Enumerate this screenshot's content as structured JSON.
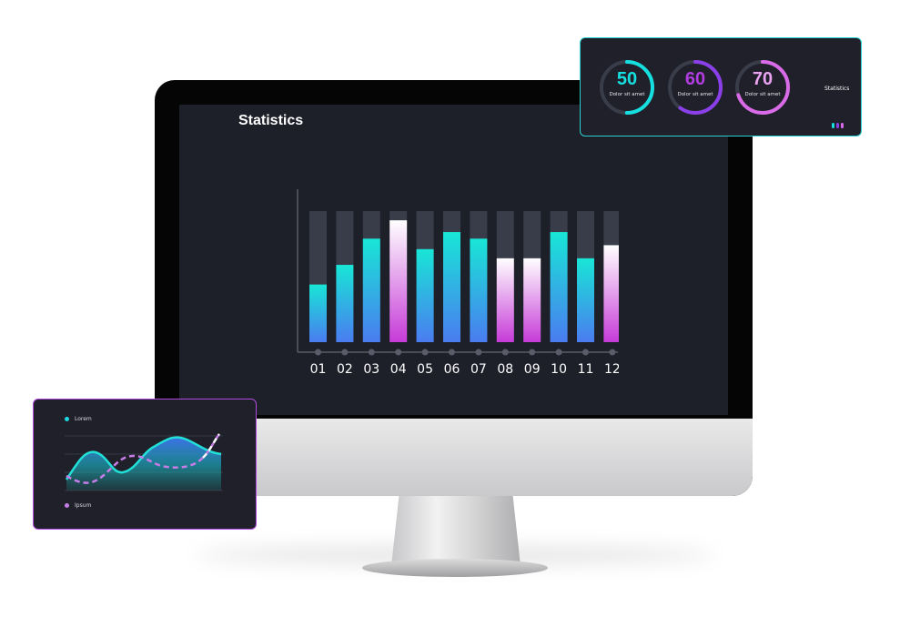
{
  "main": {
    "title": "Statistics"
  },
  "chart_data": {
    "type": "bar",
    "categories": [
      "01",
      "02",
      "03",
      "04",
      "05",
      "06",
      "07",
      "08",
      "09",
      "10",
      "11",
      "12"
    ],
    "values": [
      44,
      59,
      79,
      93,
      71,
      84,
      79,
      64,
      64,
      84,
      64,
      74
    ],
    "ylim": [
      0,
      100
    ],
    "colors": {
      "teal": "#18e6d6",
      "blue": "#4a7cf0",
      "pink": "#c63bd8",
      "white": "#ffffff",
      "track": "#393c49"
    }
  },
  "rings": [
    {
      "value": "50",
      "label": "Dolor sit amet",
      "color": "#16dfe0",
      "progress": 0.5
    },
    {
      "value": "60",
      "label": "Dolor sit amet",
      "color": "#8a3fe8",
      "progress": 0.6
    },
    {
      "value": "70",
      "label": "Dolor sit amet",
      "color": "#d96be8",
      "progress": 0.7
    }
  ],
  "ring_card": {
    "label": "Statistics"
  },
  "line_card": {
    "legend": [
      {
        "label": "Lorem",
        "color": "#1fd7e0"
      },
      {
        "label": "Ipsum",
        "color": "#c77de8"
      }
    ]
  }
}
